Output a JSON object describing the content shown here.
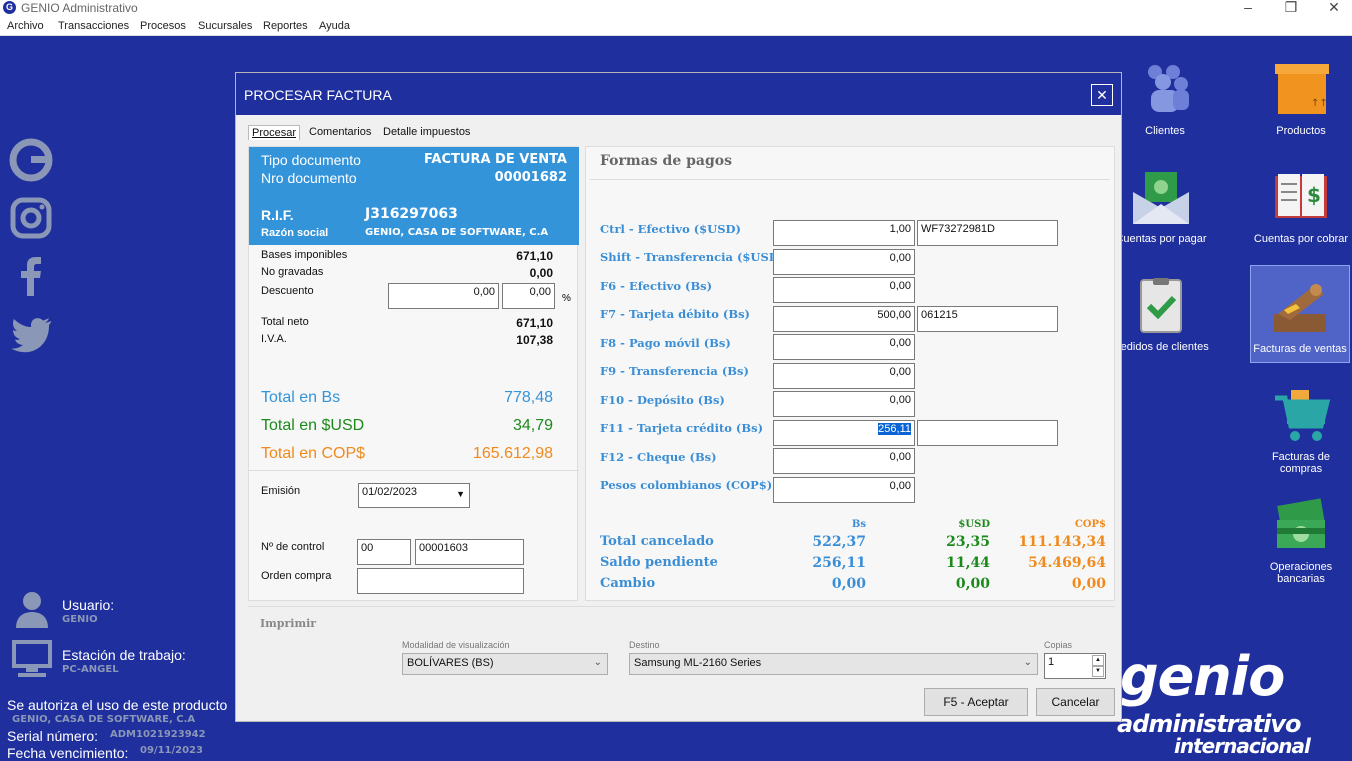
{
  "app": {
    "title": "GENIO Administrativo",
    "menu": [
      "Archivo",
      "Transacciones",
      "Procesos",
      "Sucursales",
      "Reportes",
      "Ayuda"
    ]
  },
  "left_info": {
    "usuario_label": "Usuario:",
    "usuario": "GENIO",
    "estacion_label": "Estación de trabajo:",
    "estacion": "PC-ANGEL",
    "autoriza": "Se autoriza el uso de este producto",
    "empresa": "GENIO, CASA DE SOFTWARE, C.A",
    "serial_label": "Serial número:",
    "serial": "ADM1021923942",
    "vencimiento_label": "Fecha vencimiento:",
    "vencimiento": "09/11/2023"
  },
  "shortcuts": [
    {
      "label": "Clientes",
      "icon": "clients-icon"
    },
    {
      "label": "Productos",
      "icon": "products-box-icon"
    },
    {
      "label": "Cuentas por pagar",
      "icon": "money-envelope-icon"
    },
    {
      "label": "Cuentas por cobrar",
      "icon": "ledger-dollar-icon"
    },
    {
      "label": "Pedidos de clientes",
      "icon": "clipboard-check-icon"
    },
    {
      "label": "Facturas de ventas",
      "icon": "sales-invoice-icon"
    },
    {
      "label": "Facturas de compras",
      "icon": "shopping-cart-icon"
    },
    {
      "label": "Operaciones bancarias",
      "icon": "banknotes-icon"
    }
  ],
  "brand": {
    "line1": "genio",
    "line2": "administrativo",
    "line3": "internacional"
  },
  "dialog": {
    "title": "PROCESAR FACTURA",
    "tabs": [
      "Procesar",
      "Comentarios",
      "Detalle impuestos"
    ],
    "doc": {
      "tipo_label": "Tipo documento",
      "tipo": "FACTURA DE VENTA",
      "nro_label": "Nro documento",
      "nro": "00001682",
      "rif_label": "R.I.F.",
      "rif": "J316297063",
      "razon_label": "Razón social",
      "razon": "GENIO, CASA DE SOFTWARE, C.A"
    },
    "amounts": {
      "bases_label": "Bases imponibles",
      "bases": "671,10",
      "nograv_label": "No gravadas",
      "nograv": "0,00",
      "descuento_label": "Descuento",
      "descuento": "0,00",
      "descuento_pct": "0,00",
      "pct_symbol": "%",
      "neto_label": "Total neto",
      "neto": "671,10",
      "iva_label": "I.V.A.",
      "iva": "107,38"
    },
    "totals": {
      "bs_label": "Total en Bs",
      "bs": "778,48",
      "usd_label": "Total en $USD",
      "usd": "34,79",
      "cop_label": "Total en COP$",
      "cop": "165.612,98"
    },
    "emision_label": "Emisión",
    "emision": "01/02/2023",
    "control_label": "Nº de control",
    "control_serie": "00",
    "control": "00001603",
    "orden_label": "Orden compra",
    "orden": "",
    "formas": {
      "header": "Formas de pagos",
      "rows": [
        {
          "label": "Ctrl - Efectivo ($USD)",
          "value": "1,00",
          "ref": "WF73272981D"
        },
        {
          "label": "Shift - Transferencia ($USD)",
          "value": "0,00"
        },
        {
          "label": "F6 - Efectivo (Bs)",
          "value": "0,00"
        },
        {
          "label": "F7 - Tarjeta débito (Bs)",
          "value": "500,00",
          "ref": "061215"
        },
        {
          "label": "F8 - Pago móvil (Bs)",
          "value": "0,00"
        },
        {
          "label": "F9 - Transferencia (Bs)",
          "value": "0,00"
        },
        {
          "label": "F10 - Depósito (Bs)",
          "value": "0,00"
        },
        {
          "label": "F11 - Tarjeta crédito (Bs)",
          "value": "256,11",
          "ref": ""
        },
        {
          "label": "F12 - Cheque (Bs)",
          "value": "0,00"
        },
        {
          "label": "Pesos colombianos (COP$)",
          "value": "0,00"
        }
      ]
    },
    "summary": {
      "col_bs": "Bs",
      "col_usd": "$USD",
      "col_cop": "COP$",
      "cancelado_label": "Total cancelado",
      "cancelado": [
        "522,37",
        "23,35",
        "111.143,34"
      ],
      "saldo_label": "Saldo pendiente",
      "saldo": [
        "256,11",
        "11,44",
        "54.469,64"
      ],
      "cambio_label": "Cambio",
      "cambio": [
        "0,00",
        "0,00",
        "0,00"
      ]
    },
    "imprimir": {
      "header": "Imprimir",
      "modalidad_label": "Modalidad de visualización",
      "modalidad": "BOLÍVARES (BS)",
      "destino_label": "Destino",
      "destino": "Samsung ML-2160 Series",
      "copias_label": "Copias",
      "copias": "1"
    },
    "buttons": {
      "aceptar": "F5 - Aceptar",
      "cancelar": "Cancelar"
    }
  },
  "colors": {
    "desktop": "#1f2f9e",
    "header_blue": "#3494da",
    "green": "#1b8a1b",
    "orange": "#f08a1c",
    "label_blue": "#3a8ed6"
  }
}
